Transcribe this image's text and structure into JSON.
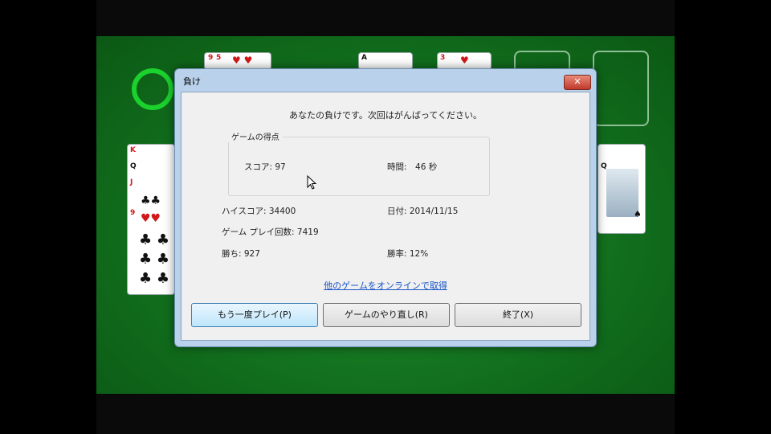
{
  "dialog": {
    "title": "負け",
    "close_label": "✕",
    "message": "あなたの負けです。次回はがんばってください。",
    "group_title": "ゲームの得点",
    "score_label": "スコア: 97",
    "time_label": "時間:　46 秒",
    "high_score_label": "ハイスコア: 34400",
    "date_label": "日付: 2014/11/15",
    "games_played_label": "ゲーム プレイ回数: 7419",
    "wins_label": "勝ち: 927",
    "win_rate_label": "勝率: 12%",
    "online_link": "他のゲームをオンラインで取得",
    "buttons": {
      "play_again": "もう一度プレイ(P)",
      "restart": "ゲームのやり直し(R)",
      "exit": "終了(X)"
    }
  },
  "cards": {
    "top1": "9",
    "top2": "5",
    "top3": "A",
    "top4": "3",
    "left_k": "K",
    "left_q": "Q",
    "left_j": "J",
    "left_nine": "9",
    "right_q": "Q"
  },
  "colors": {
    "felt": "#12701e",
    "accent": "#1bd12d"
  }
}
